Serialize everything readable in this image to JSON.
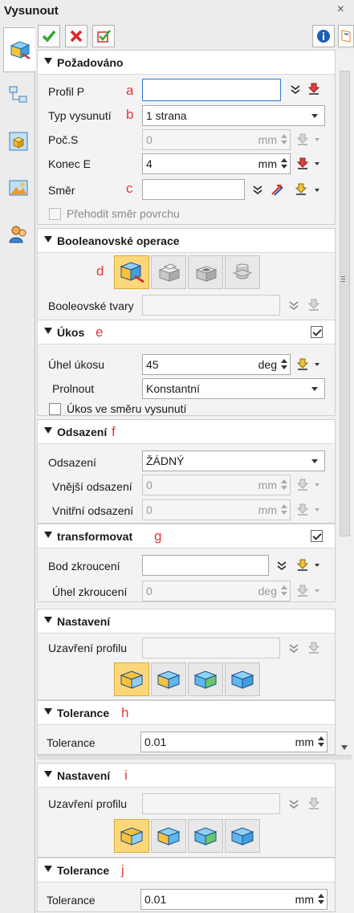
{
  "window": {
    "title": "Vysunout",
    "close_glyph": "×"
  },
  "toolbar": {
    "ok_icon": "check-icon",
    "cancel_icon": "x-icon",
    "apply_icon": "apply-check-icon",
    "info_icon": "info-icon",
    "help_icon": "help-book-icon"
  },
  "sidetabs": [
    "extrude-tab",
    "tree-tab",
    "part-tab",
    "image-tab",
    "user-tab"
  ],
  "required": {
    "title": "Požadováno",
    "profile": {
      "label": "Profil P",
      "marker": "a",
      "value": ""
    },
    "extrude_type": {
      "label": "Typ vysunutí",
      "marker": "b",
      "value": "1 strana"
    },
    "start": {
      "label": "Poč.S",
      "value": "0",
      "unit": "mm"
    },
    "end": {
      "label": "Konec E",
      "value": "4",
      "unit": "mm"
    },
    "direction": {
      "label": "Směr",
      "marker": "c",
      "value": ""
    },
    "flip": {
      "label": "Přehodit směr povrchu",
      "checked": false
    }
  },
  "boolean": {
    "title": "Booleanovské operace",
    "marker": "d",
    "selected_index": 0,
    "ops": [
      "base-op-icon",
      "add-op-icon",
      "subtract-op-icon",
      "intersect-op-icon"
    ],
    "shapes_label": "Booleovské tvary"
  },
  "draft": {
    "title": "Úkos",
    "marker": "e",
    "enabled": true,
    "angle": {
      "label": "Úhel úkosu",
      "value": "45",
      "unit": "deg"
    },
    "blend": {
      "label": "Prolnout",
      "value": "Konstantní"
    },
    "along": {
      "label": "Úkos ve směru vysunutí",
      "checked": false
    }
  },
  "offset": {
    "title": "Odsazení",
    "marker": "f",
    "mode": {
      "label": "Odsazení",
      "value": "ŽÁDNÝ"
    },
    "outer": {
      "label": "Vnější odsazení",
      "value": "0",
      "unit": "mm"
    },
    "inner": {
      "label": "Vnitřní odsazení",
      "value": "0",
      "unit": "mm"
    }
  },
  "transform": {
    "title": "transformovat",
    "marker": "g",
    "enabled": true,
    "twist_point": {
      "label": "Bod zkroucení",
      "value": ""
    },
    "twist_angle": {
      "label": "Úhel zkroucení",
      "value": "0",
      "unit": "deg"
    }
  },
  "settings1": {
    "title": "Nastavení",
    "profile_close": {
      "label": "Uzavření profilu"
    },
    "caps": [
      "cap-both-icon",
      "cap-start-icon",
      "cap-end-icon",
      "cap-none-icon"
    ],
    "selected_index": 0
  },
  "tolerance1": {
    "title": "Tolerance",
    "marker": "h",
    "label": "Tolerance",
    "value": "0.01",
    "unit": "mm"
  },
  "settings2": {
    "title": "Nastavení",
    "marker": "i",
    "profile_close": {
      "label": "Uzavření profilu"
    },
    "caps": [
      "cap-both-icon",
      "cap-start-icon",
      "cap-end-icon",
      "cap-none-icon"
    ],
    "selected_index": 0
  },
  "tolerance2": {
    "title": "Tolerance",
    "marker": "j",
    "label": "Tolerance",
    "value": "0.01",
    "unit": "mm"
  },
  "colors": {
    "accent": "#2e7bd6",
    "marker": "#e53935",
    "active_button": "#fcd77a"
  }
}
